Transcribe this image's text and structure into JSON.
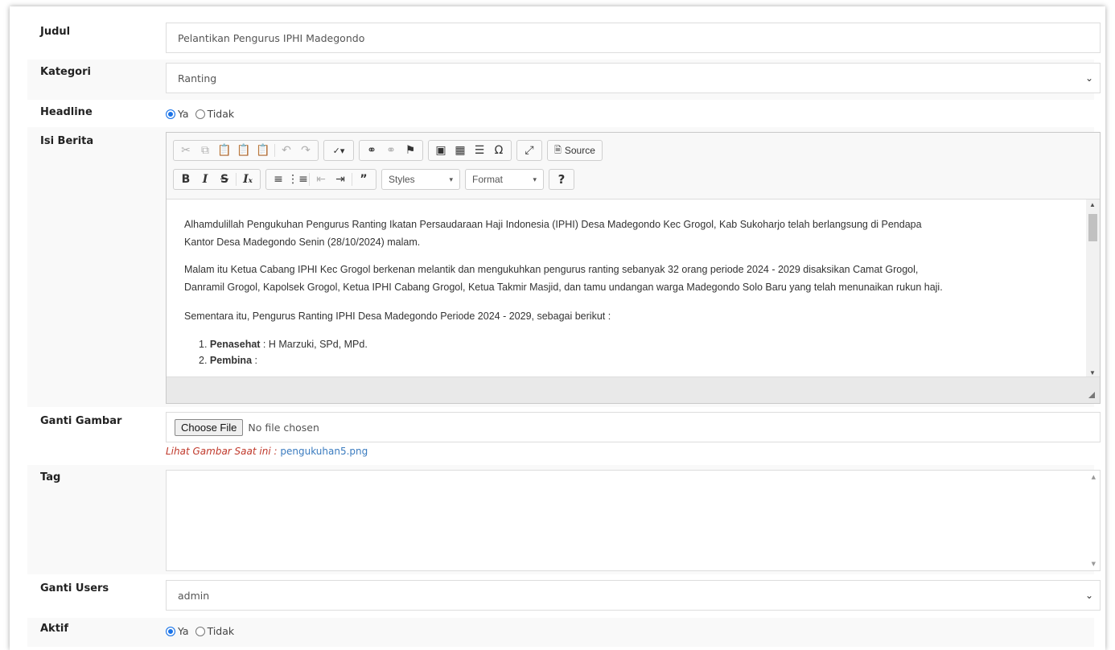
{
  "form": {
    "judul": {
      "label": "Judul",
      "value": "Pelantikan Pengurus IPHI Madegondo"
    },
    "kategori": {
      "label": "Kategori",
      "value": "Ranting"
    },
    "headline": {
      "label": "Headline",
      "options": [
        "Ya",
        "Tidak"
      ],
      "selected": "Ya"
    },
    "isi": {
      "label": "Isi Berita",
      "toolbar": {
        "source_label": "Source",
        "styles_label": "Styles",
        "format_label": "Format",
        "help_label": "?"
      },
      "paragraphs": [
        "Alhamdulillah Pengukuhan Pengurus Ranting Ikatan Persaudaraan Haji Indonesia (IPHI) Desa Madegondo Kec Grogol, Kab Sukoharjo telah berlangsung di Pendapa",
        "Kantor Desa Madegondo Senin (28/10/2024) malam.",
        "Malam itu Ketua Cabang IPHI Kec Grogol berkenan melantik dan mengukuhkan pengurus ranting sebanyak 32 orang periode 2024 - 2029 disaksikan Camat Grogol,",
        "Danramil Grogol, Kapolsek Grogol, Ketua IPHI Cabang Grogol, Ketua Takmir Masjid, dan tamu undangan warga Madegondo Solo Baru yang telah menunaikan rukun haji.",
        "Sementara itu, Pengurus Ranting IPHI Desa Madegondo Periode 2024 - 2029, sebagai berikut :"
      ],
      "list": [
        {
          "num": "1.",
          "term": "Penasehat",
          "rest": " : H Marzuki, SPd, MPd."
        },
        {
          "num": "2.",
          "term": "Pembina",
          "rest": " :"
        }
      ]
    },
    "gambar": {
      "label": "Ganti Gambar",
      "button": "Choose File",
      "status": "No file chosen",
      "current_prefix": "Lihat Gambar Saat ini :",
      "current_file": "pengukuhan5.png"
    },
    "tag": {
      "label": "Tag",
      "value": ""
    },
    "users": {
      "label": "Ganti Users",
      "value": "admin"
    },
    "aktif": {
      "label": "Aktif",
      "options": [
        "Ya",
        "Tidak"
      ],
      "selected": "Ya"
    }
  },
  "colors": {
    "accent": "#1a73e8",
    "link": "#3a7bbf",
    "danger_label": "#c0392b"
  }
}
